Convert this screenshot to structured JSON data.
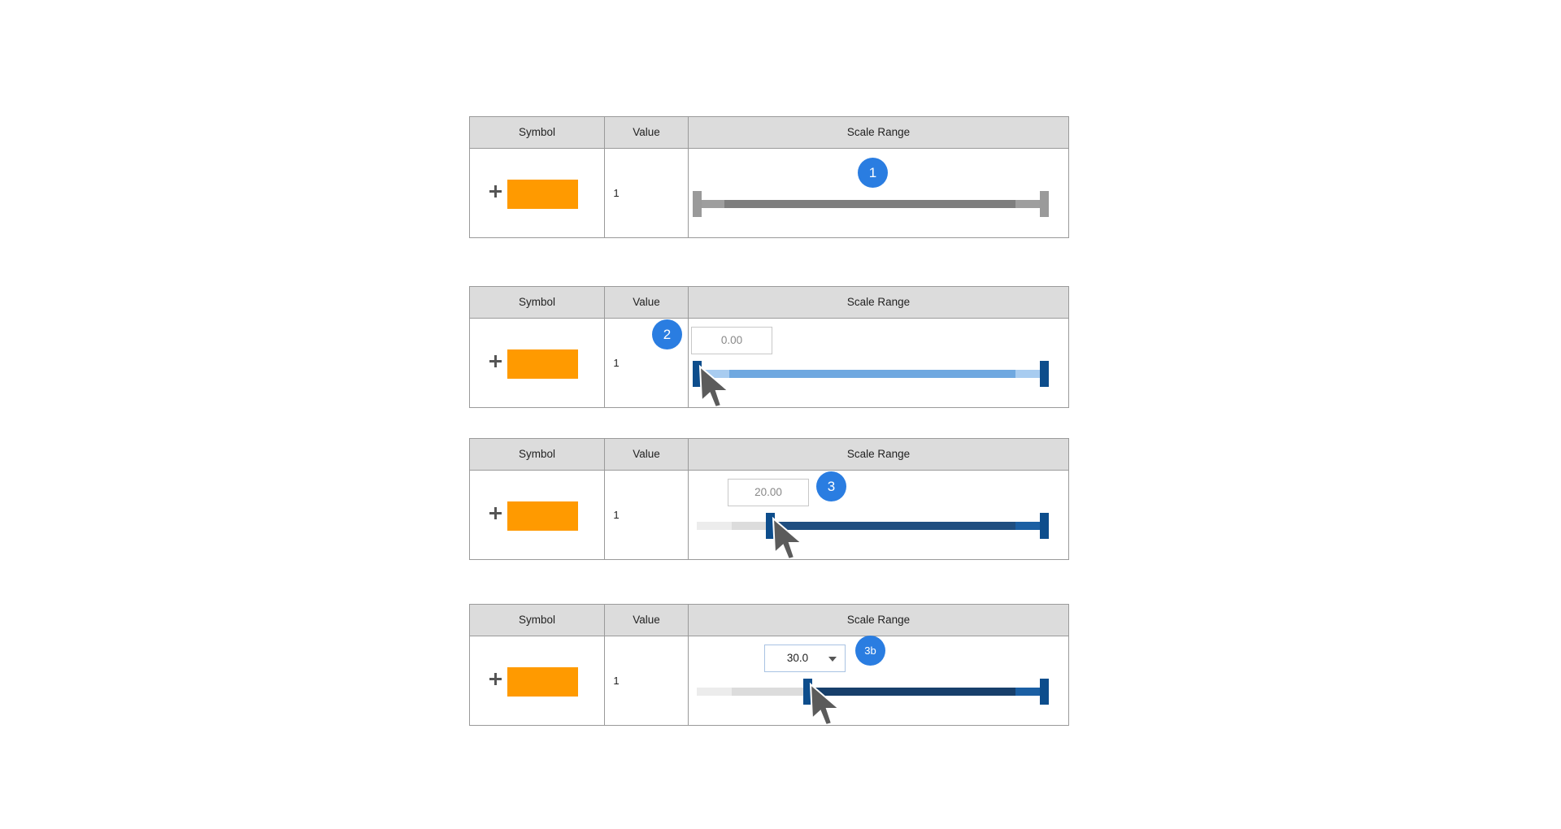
{
  "headers": {
    "symbol": "Symbol",
    "value": "Value",
    "scale_range": "Scale Range"
  },
  "colors": {
    "symbol_fill": "#ff9a00",
    "header_bg": "#dcdcdc",
    "badge": "#2a7de1",
    "track_gray": "#8a8a8a",
    "track_light_blue": "#6fa8e0",
    "track_dark_blue": "#1f4e80",
    "handle_blue": "#0d4d8c"
  },
  "icons": {
    "expand": "plus-icon",
    "pointer": "mouse-cursor-icon",
    "dropdown": "chevron-down-icon"
  },
  "rows": [
    {
      "value": "1",
      "badge": "1",
      "range_input": ""
    },
    {
      "value": "1",
      "badge": "2",
      "range_input": "0.00"
    },
    {
      "value": "1",
      "badge": "3",
      "range_input": "20.00"
    },
    {
      "value": "1",
      "badge": "3b",
      "range_input": "30.0"
    }
  ]
}
